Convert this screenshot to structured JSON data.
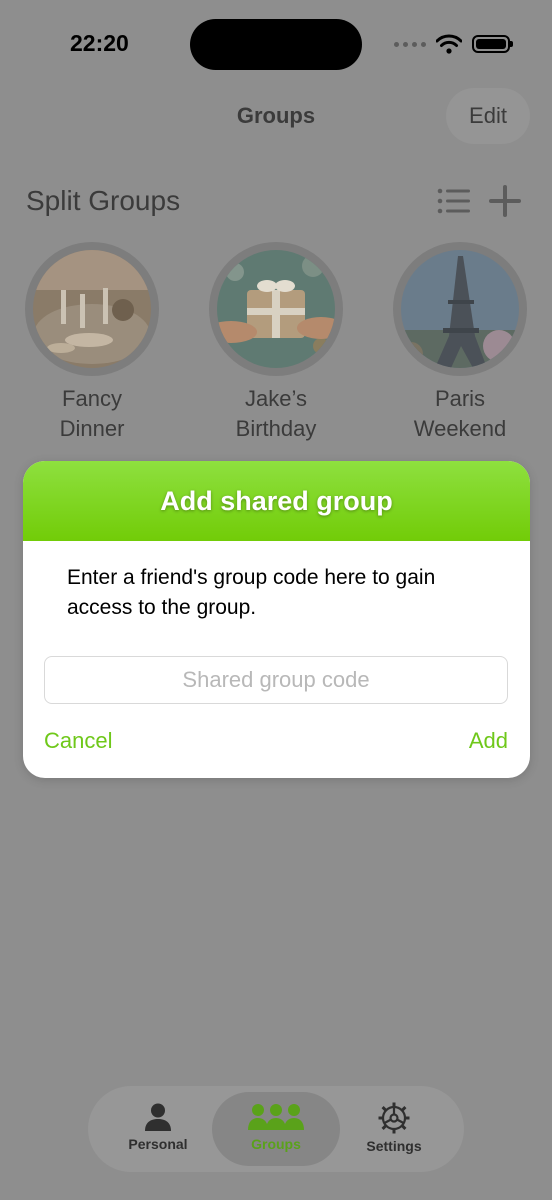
{
  "status_bar": {
    "time": "22:20"
  },
  "nav": {
    "title": "Groups",
    "edit_label": "Edit"
  },
  "section": {
    "title": "Split Groups",
    "icons": [
      "list-icon",
      "plus-icon"
    ]
  },
  "groups": [
    {
      "line1": "Fancy",
      "line2": "Dinner",
      "photo": "restaurant-table-photo"
    },
    {
      "line1": "Jake’s",
      "line2": "Birthday",
      "photo": "gift-box-photo"
    },
    {
      "line1": "Paris",
      "line2": "Weekend",
      "photo": "eiffel-tower-photo"
    }
  ],
  "dialog": {
    "title": "Add shared group",
    "message": "Enter a friend's group code here to gain access to the group.",
    "input_placeholder": "Shared group code",
    "input_value": "",
    "cancel_label": "Cancel",
    "add_label": "Add"
  },
  "tabbar": {
    "tabs": [
      {
        "label": "Personal",
        "icon": "person-icon",
        "selected": false
      },
      {
        "label": "Groups",
        "icon": "group-icon",
        "selected": true
      },
      {
        "label": "Settings",
        "icon": "gear-icon",
        "selected": false
      }
    ]
  },
  "colors": {
    "accent": "#72cc08",
    "dim_background": "#8e8e8e",
    "dialog_background": "#ffffff"
  }
}
